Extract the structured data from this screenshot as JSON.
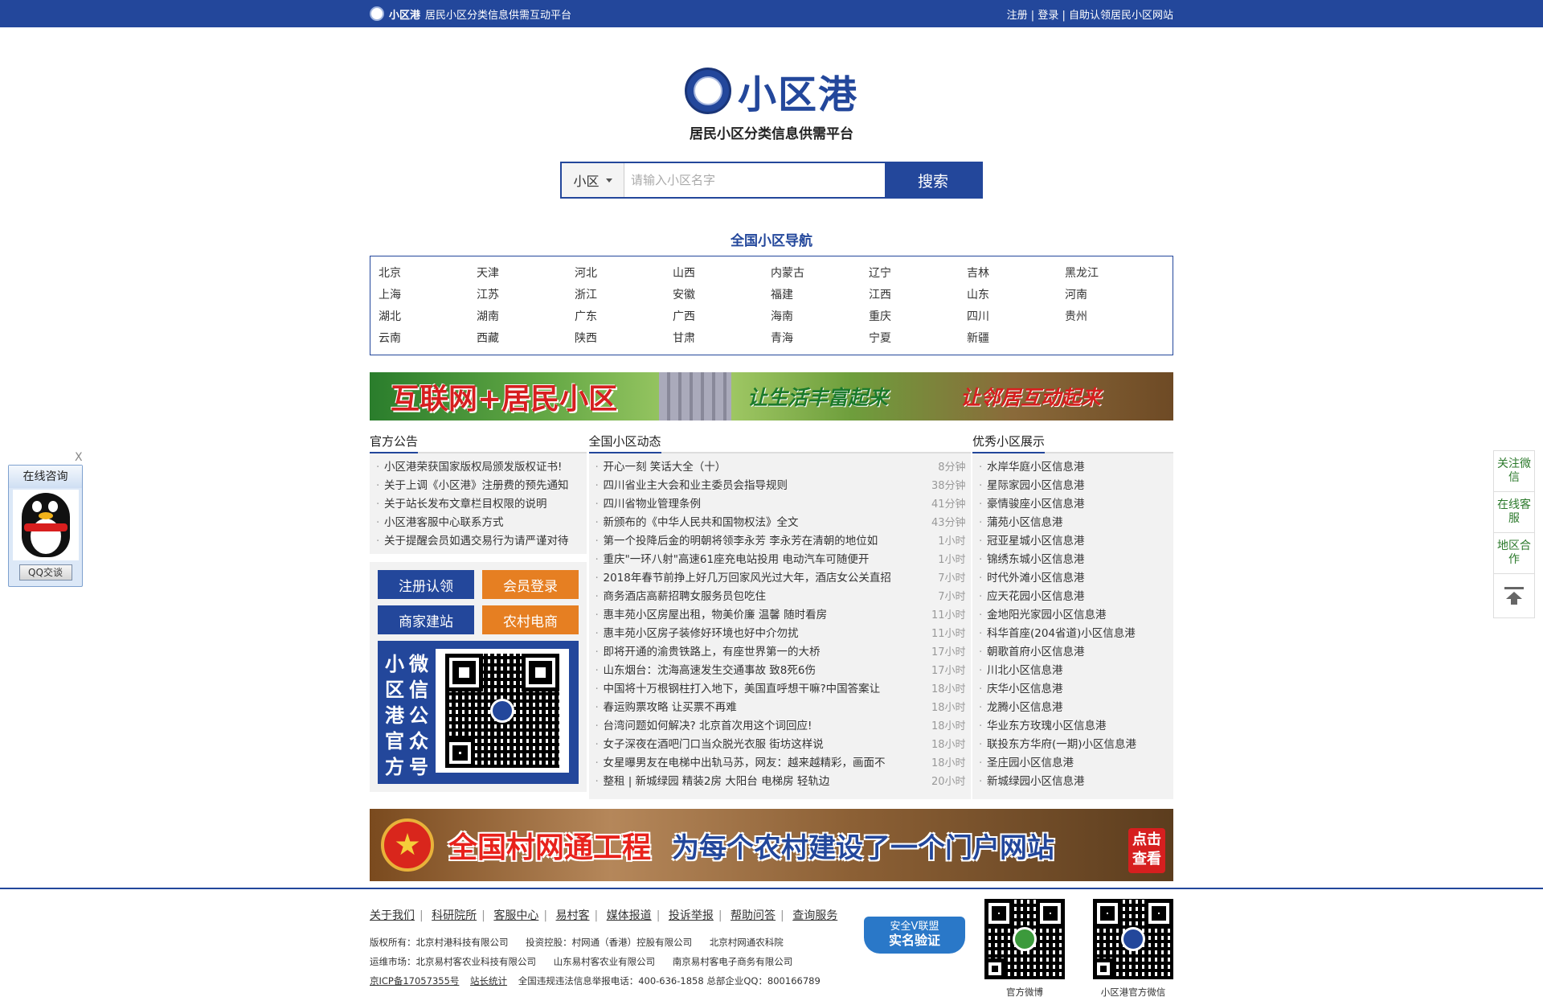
{
  "topbar": {
    "brand": "小区港",
    "slogan": "居民小区分类信息供需互动平台",
    "links": [
      "注册",
      "登录",
      "自助认领居民小区网站"
    ]
  },
  "logo": {
    "title": "小区港",
    "subtitle": "居民小区分类信息供需平台"
  },
  "search": {
    "scope": "小区",
    "placeholder": "请输入小区名字",
    "button": "搜索"
  },
  "nav": {
    "title": "全国小区导航",
    "provinces": [
      "北京",
      "天津",
      "河北",
      "山西",
      "内蒙古",
      "辽宁",
      "吉林",
      "黑龙江",
      "上海",
      "江苏",
      "浙江",
      "安徽",
      "福建",
      "江西",
      "山东",
      "河南",
      "湖北",
      "湖南",
      "广东",
      "广西",
      "海南",
      "重庆",
      "四川",
      "贵州",
      "云南",
      "西藏",
      "陕西",
      "甘肃",
      "青海",
      "宁夏",
      "新疆"
    ]
  },
  "banner1": {
    "main": "互联网+居民小区",
    "s1": "让生活丰富起来",
    "s2": "让邻居互动起来"
  },
  "announcements": {
    "title": "官方公告",
    "items": [
      "小区港荣获国家版权局颁发版权证书!",
      "关于上调《小区港》注册费的预先通知",
      "关于站长发布文章栏目权限的说明",
      "小区港客服中心联系方式",
      "关于提醒会员如遇交易行为请严谨对待"
    ]
  },
  "buttons": {
    "register": "注册认领",
    "login": "会员登录",
    "merchant": "商家建站",
    "rural": "农村电商"
  },
  "wechat_card": {
    "chars": [
      "小",
      "区",
      "港",
      "官",
      "方",
      "微",
      "信",
      "公",
      "众",
      "号"
    ]
  },
  "news": {
    "title": "全国小区动态",
    "items": [
      {
        "title": "开心一刻 笑话大全（十）",
        "time": "8分钟"
      },
      {
        "title": "四川省业主大会和业主委员会指导规则",
        "time": "38分钟"
      },
      {
        "title": "四川省物业管理条例",
        "time": "41分钟"
      },
      {
        "title": "新颁布的《中华人民共和国物权法》全文",
        "time": "43分钟"
      },
      {
        "title": "第一个投降后金的明朝将领李永芳 李永芳在清朝的地位如",
        "time": "1小时"
      },
      {
        "title": "重庆\"一环八射\"高速61座充电站投用 电动汽车可随便开",
        "time": "1小时"
      },
      {
        "title": "2018年春节前挣上好几万回家风光过大年，酒店女公关直招",
        "time": "7小时"
      },
      {
        "title": "商务酒店高薪招聘女服务员包吃住",
        "time": "7小时"
      },
      {
        "title": "惠丰苑小区房屋出租，物美价廉 温馨 随时看房",
        "time": "11小时"
      },
      {
        "title": "惠丰苑小区房子装修好环境也好中介勿扰",
        "time": "11小时"
      },
      {
        "title": "即将开通的渝贵铁路上，有座世界第一的大桥",
        "time": "17小时"
      },
      {
        "title": "山东烟台：沈海高速发生交通事故 致8死6伤",
        "time": "17小时"
      },
      {
        "title": "中国将十万根钢柱打入地下，美国直呼想干嘛?中国答案让",
        "time": "18小时"
      },
      {
        "title": "春运购票攻略 让买票不再难",
        "time": "18小时"
      },
      {
        "title": "台湾问题如何解决? 北京首次用这个词回应!",
        "time": "18小时"
      },
      {
        "title": "女子深夜在酒吧门口当众脱光衣服 街坊这样说",
        "time": "18小时"
      },
      {
        "title": "女星曝男友在电梯中出轨马苏，网友：越来越精彩，画面不",
        "time": "18小时"
      },
      {
        "title": "整租 | 新城绿园 精装2房 大阳台 电梯房 轻轨边",
        "time": "20小时"
      }
    ]
  },
  "showcase": {
    "title": "优秀小区展示",
    "items": [
      "水岸华庭小区信息港",
      "星际家园小区信息港",
      "豪情骏座小区信息港",
      "蒲苑小区信息港",
      "冠亚星城小区信息港",
      "锦绣东城小区信息港",
      "时代外滩小区信息港",
      "应天花园小区信息港",
      "金地阳光家园小区信息港",
      "科华首座(204省道)小区信息港",
      "朝歌首府小区信息港",
      "川北小区信息港",
      "庆华小区信息港",
      "龙腾小区信息港",
      "华业东方玫瑰小区信息港",
      "联投东方华府(一期)小区信息港",
      "圣庄园小区信息港",
      "新城绿园小区信息港"
    ]
  },
  "banner2": {
    "t1": "全国村网通工程",
    "t2": "为每个农村建设了一个门户网站",
    "cta1": "点击",
    "cta2": "查看"
  },
  "footer": {
    "links": [
      "关于我们",
      "科研院所",
      "客服中心",
      "易村客",
      "媒体报道",
      "投诉举报",
      "帮助问答",
      "查询服务"
    ],
    "copyright_label": "版权所有：北京村港科技有限公司",
    "holding": "投资控股：村网通（香港）控股有限公司",
    "academy": "北京村网通农科院",
    "ops_label": "运维市场：北京易村客农业科技有限公司",
    "ops2": "山东易村客农业有限公司",
    "ops3": "南京易村客电子商务有限公司",
    "icp": "京ICP备17057355号",
    "stats": "站长统计",
    "report": "全国违规违法信息举报电话：400-636-1858 总部企业QQ：800166789",
    "badge_top": "安全V联盟",
    "badge_main": "实名验证",
    "qr1_caption": "官方微博",
    "qr2_caption": "小区港官方微信"
  },
  "float_qq": {
    "close": "X",
    "title": "在线咨询",
    "button": "QQ交谈"
  },
  "side_tools": [
    "关注微信",
    "在线客服",
    "地区合作"
  ],
  "colors": {
    "brand_blue": "#23479b",
    "orange": "#e67f22",
    "red": "#d61f1f",
    "side_green": "#2c7a2c"
  }
}
